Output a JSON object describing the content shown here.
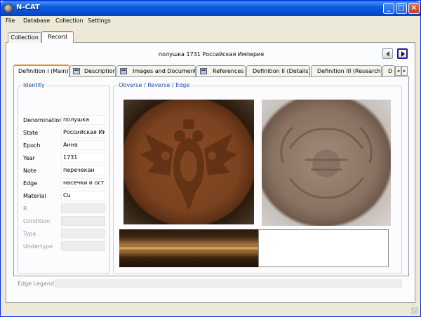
{
  "window": {
    "title": "N-CAT"
  },
  "menu": [
    "File",
    "Database",
    "Collection",
    "Settings"
  ],
  "top_tabs": [
    {
      "label": "Collection",
      "active": false
    },
    {
      "label": "Record",
      "active": true
    }
  ],
  "record": {
    "title": "полушка 1731 Российская Империя"
  },
  "inner_tabs": [
    {
      "label": "Definition I (Main)",
      "active": true,
      "icon": null
    },
    {
      "label": "Description",
      "active": false,
      "icon": "edit-icon"
    },
    {
      "label": "Images and Documents",
      "active": false,
      "icon": "document-icon"
    },
    {
      "label": "References",
      "active": false,
      "icon": "document-icon"
    },
    {
      "label": "Definition II (Details)",
      "active": false,
      "icon": null
    },
    {
      "label": "Definition III (Research)",
      "active": false,
      "icon": null
    },
    {
      "label": "D",
      "active": false,
      "icon": null
    }
  ],
  "identity": {
    "group_label": "Identity",
    "fields": [
      {
        "label": "Denomination",
        "value": "полушка",
        "enabled": true
      },
      {
        "label": "State",
        "value": "Российская Импе",
        "enabled": true
      },
      {
        "label": "Epoch",
        "value": "Анна",
        "enabled": true
      },
      {
        "label": "Year",
        "value": "1731",
        "enabled": true
      },
      {
        "label": "Note",
        "value": "перечекан",
        "enabled": true
      },
      {
        "label": "Edge",
        "value": "насечки и остат",
        "enabled": true
      },
      {
        "label": "Material",
        "value": "Cu",
        "enabled": true
      },
      {
        "label": "R",
        "value": "",
        "enabled": false
      },
      {
        "label": "Condition",
        "value": "",
        "enabled": false
      },
      {
        "label": "Type",
        "value": "",
        "enabled": false
      },
      {
        "label": "Undertype",
        "value": "",
        "enabled": false
      }
    ]
  },
  "images": {
    "group_label": "Obverse / Reverse / Edge"
  },
  "edge_legend": {
    "label": "Edge Legend",
    "value": ""
  },
  "colors": {
    "title_bar": "#0a5ee0",
    "active_tab_accent": "#e68b2c",
    "group_label": "#1c50b0"
  }
}
